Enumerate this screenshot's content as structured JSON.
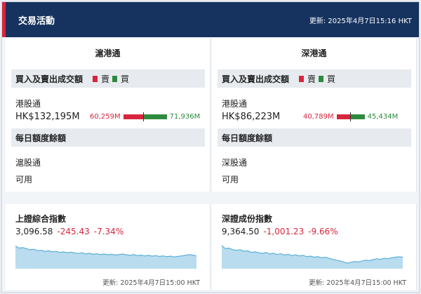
{
  "header": {
    "title": "交易活動",
    "updated": "更新: 2025年4月7日15:16 HKT"
  },
  "left": {
    "title": "滬港通",
    "turnover_title": "買入及賣出成交額",
    "legend_sell": "賣",
    "legend_buy": "買",
    "channel": "港股通",
    "total": "HK$132,195M",
    "sell": "60,259M",
    "buy": "71,936M",
    "sell_share": 0.456,
    "quota_title": "每日額度餘額",
    "quota_channel": "滬股通",
    "quota_status": "可用"
  },
  "right": {
    "title": "深港通",
    "turnover_title": "買入及賣出成交額",
    "legend_sell": "賣",
    "legend_buy": "買",
    "channel": "港股通",
    "total": "HK$86,223M",
    "sell": "40,789M",
    "buy": "45,434M",
    "sell_share": 0.473,
    "quota_title": "每日額度餘額",
    "quota_channel": "深股通",
    "quota_status": "可用"
  },
  "indices": [
    {
      "name": "上證綜合指數",
      "price": "3,096.58",
      "change": "-245.43",
      "pct": "-7.34%",
      "updated": "更新: 2025年4月7日15:00 HKT",
      "series": [
        0.8,
        0.72,
        0.74,
        0.7,
        0.66,
        0.68,
        0.62,
        0.64,
        0.6,
        0.62,
        0.58,
        0.6,
        0.56,
        0.58,
        0.55,
        0.57,
        0.54,
        0.52,
        0.55,
        0.5,
        0.53,
        0.49,
        0.51,
        0.48,
        0.5,
        0.47,
        0.49,
        0.46,
        0.48,
        0.5,
        0.47,
        0.45,
        0.48,
        0.44,
        0.46,
        0.43,
        0.45,
        0.42,
        0.44,
        0.41,
        0.43,
        0.4,
        0.42,
        0.39,
        0.41,
        0.43,
        0.45,
        0.48,
        0.46,
        0.42
      ]
    },
    {
      "name": "深證成份指數",
      "price": "9,364.50",
      "change": "-1,001.23",
      "pct": "-9.66%",
      "updated": "更新: 2025年4月7日15:00 HKT",
      "series": [
        0.82,
        0.7,
        0.72,
        0.66,
        0.64,
        0.66,
        0.6,
        0.62,
        0.56,
        0.58,
        0.55,
        0.52,
        0.56,
        0.5,
        0.53,
        0.48,
        0.51,
        0.46,
        0.49,
        0.44,
        0.47,
        0.43,
        0.45,
        0.4,
        0.42,
        0.38,
        0.4,
        0.36,
        0.38,
        0.34,
        0.3,
        0.27,
        0.24,
        0.2,
        0.16,
        0.19,
        0.22,
        0.2,
        0.24,
        0.27,
        0.25,
        0.29,
        0.32,
        0.3,
        0.34,
        0.32,
        0.36,
        0.38,
        0.4,
        0.38
      ]
    }
  ],
  "colors": {
    "header": "#16325f",
    "accent": "#d7263d",
    "sell": "#d7263d",
    "buy": "#2e8b3e",
    "spark_fill": "#b9dcef",
    "spark_line": "#5aaed6"
  }
}
